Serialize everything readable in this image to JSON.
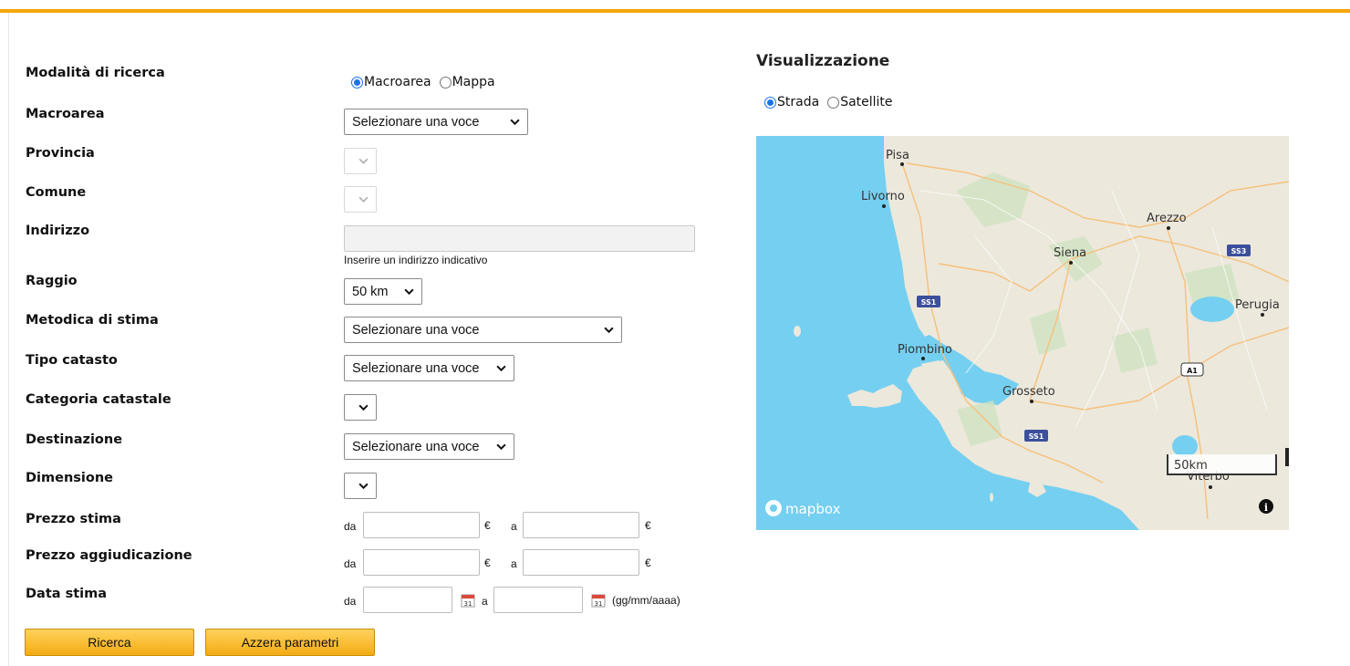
{
  "form": {
    "labels": {
      "modalita": "Modalità di ricerca",
      "macroarea": "Macroarea",
      "provincia": "Provincia",
      "comune": "Comune",
      "indirizzo": "Indirizzo",
      "raggio": "Raggio",
      "metodica": "Metodica di stima",
      "tipo_catasto": "Tipo catasto",
      "categoria": "Categoria catastale",
      "destinazione": "Destinazione",
      "dimensione": "Dimensione",
      "prezzo_stima": "Prezzo stima",
      "prezzo_agg": "Prezzo aggiudicazione",
      "data_stima": "Data stima"
    },
    "modalita_options": [
      "Macroarea",
      "Mappa"
    ],
    "macroarea_value": "Selezionare una voce",
    "indirizzo_hint": "Inserire un indirizzo indicativo",
    "raggio_value": "50 km",
    "metodica_value": "Selezionare una voce",
    "tipo_catasto_value": "Selezionare una voce",
    "destinazione_value": "Selezionare una voce",
    "range_from": "da",
    "range_to": "a",
    "currency": "€",
    "date_format": "(gg/mm/aaaa)"
  },
  "buttons": {
    "search": "Ricerca",
    "reset": "Azzera parametri"
  },
  "map_panel": {
    "title": "Visualizzazione",
    "options": [
      "Strada",
      "Satellite"
    ],
    "cities": {
      "pisa": "Pisa",
      "livorno": "Livorno",
      "arezzo": "Arezzo",
      "siena": "Siena",
      "perugia": "Perugia",
      "piombino": "Piombino",
      "grosseto": "Grosseto",
      "viterbo": "Viterbo"
    },
    "roads": {
      "ss1": "SS1",
      "ss3": "SS3",
      "a1": "A1"
    },
    "scale": "50km",
    "attribution": "mapbox"
  },
  "colors": {
    "accent": "#f4a700",
    "sea": "#75cff0",
    "land": "#ece8dc"
  }
}
